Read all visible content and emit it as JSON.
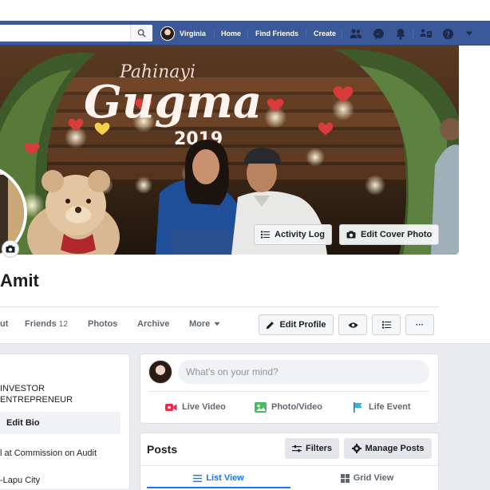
{
  "colors": {
    "nav_bg": "#3b5998",
    "accent_blue": "#1877f2",
    "content_bg": "#e9ebee",
    "card_bg": "#ffffff",
    "live_video_red": "#f02849",
    "photo_green": "#45bd62",
    "life_event_blue": "#1b74e4"
  },
  "topbar": {
    "search": {
      "value": "",
      "icon": "search-icon"
    },
    "user_name": "Virginia",
    "links": {
      "home": "Home",
      "find_friends": "Find Friends",
      "create": "Create"
    },
    "icons": [
      "friends-icon",
      "messenger-icon",
      "notifications-bell-icon",
      "quick-help-people-icon",
      "help-question-icon",
      "account-caret-icon"
    ]
  },
  "cover": {
    "activity_log_label": "Activity Log",
    "edit_cover_label": "Edit Cover Photo",
    "sign_text": "Gugma",
    "sign_script": "Pahinayi",
    "sign_year": "2019"
  },
  "profile": {
    "name": "Amit"
  },
  "tabs": {
    "about": "ut",
    "friends": "Friends",
    "friends_count": "12",
    "photos": "Photos",
    "archive": "Archive",
    "more": "More"
  },
  "actions": {
    "edit_profile": "Edit Profile",
    "view_as_icon": "eye-icon",
    "activity_icon": "list-icon",
    "more_icon": "ellipsis-icon",
    "more_label": "···"
  },
  "intro": {
    "line1": "INVESTOR",
    "line2": " ENTREPRENEUR",
    "edit_bio": "Edit Bio",
    "work": "l at Commission on Audit",
    "city": "-Lapu City"
  },
  "composer": {
    "placeholder": "What's on your mind?",
    "live_video": "Live Video",
    "photo_video": "Photo/Video",
    "life_event": "Life Event"
  },
  "posts": {
    "title": "Posts",
    "filters": "Filters",
    "manage": "Manage Posts",
    "list_view": "List View",
    "grid_view": "Grid View"
  }
}
